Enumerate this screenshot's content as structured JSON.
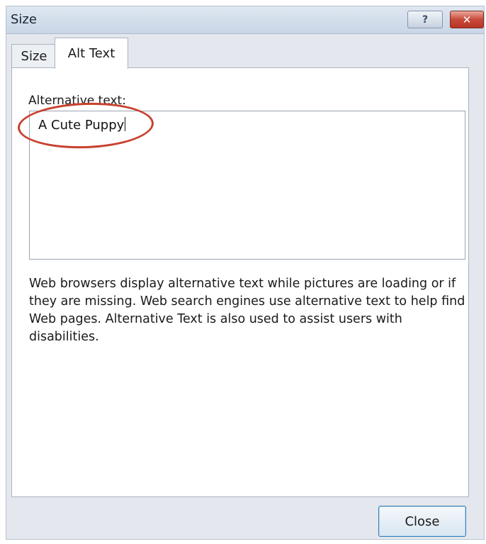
{
  "window": {
    "title": "Size"
  },
  "title_buttons": {
    "help_glyph": "?",
    "close_glyph": "✕"
  },
  "tabs": [
    {
      "label": "Size",
      "selected": false
    },
    {
      "label": "Alt Text",
      "selected": true
    }
  ],
  "alt_text": {
    "label": "Alternative text:",
    "value": "A Cute Puppy",
    "description": "Web browsers display alternative text while pictures are loading or if they are missing.  Web search engines use alternative text to help find Web pages.  Alternative Text is also used to assist users with disabilities."
  },
  "annotation": {
    "color": "#c8402f",
    "shape": "ellipse"
  },
  "footer": {
    "close_label": "Close"
  }
}
